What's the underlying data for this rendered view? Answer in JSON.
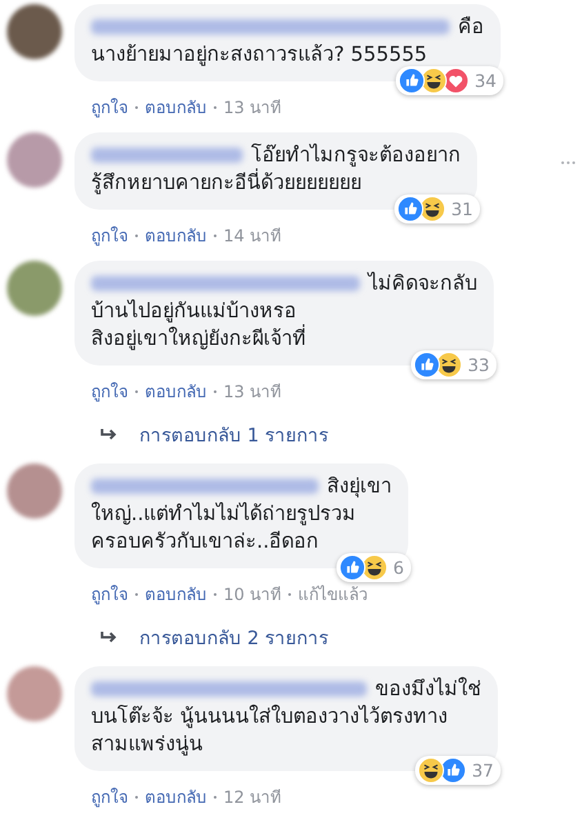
{
  "comments": [
    {
      "text": "คือ\nนางย้ายมาอยู่กะสงถาวรแล้ว? 555555",
      "reactions": [
        {
          "kind": "like"
        },
        {
          "kind": "haha"
        },
        {
          "kind": "love"
        }
      ],
      "reaction_count": "34",
      "actions": [
        "ถูกใจ",
        "ตอบกลับ"
      ],
      "time": "13 นาที",
      "show_menu": false
    },
    {
      "text": "โอ๊ยทำไมกรูจะต้องอยาก\nรู้สึกหยาบคายกะอีนี่ด้วยยยยยยย",
      "reactions": [
        {
          "kind": "like"
        },
        {
          "kind": "haha"
        }
      ],
      "reaction_count": "31",
      "actions": [
        "ถูกใจ",
        "ตอบกลับ"
      ],
      "time": "14 นาที",
      "show_menu": true
    },
    {
      "text": "ไม่คิดจะกลับ\nบ้านไปอยู่กันแม่บ้างหรอ\nสิงอยู่เขาใหญ่ยังกะผีเจ้าที่",
      "reactions": [
        {
          "kind": "like"
        },
        {
          "kind": "haha"
        }
      ],
      "reaction_count": "33",
      "actions": [
        "ถูกใจ",
        "ตอบกลับ"
      ],
      "time": "13 นาที",
      "show_menu": false,
      "replies_label": "การตอบกลับ 1 รายการ"
    },
    {
      "text": "สิงยุ่เขา\nใหญ่..แต่ทำไมไม่ได้ถ่ายรูปรวม\nครอบครัวกับเขาล่ะ..อีดอก",
      "reactions": [
        {
          "kind": "like"
        },
        {
          "kind": "haha"
        }
      ],
      "reaction_count": "6",
      "actions": [
        "ถูกใจ",
        "ตอบกลับ"
      ],
      "time": "10 นาที",
      "edited_label": "แก้ไขแล้ว",
      "show_menu": false,
      "replies_label": "การตอบกลับ 2 รายการ"
    },
    {
      "text": "ของมึงไม่ใช่\nบนโต๊ะจ้ะ นู้นนนนใส่ใบตองวางไว้ตรงทาง\nสามแพร่งนู่น",
      "reactions": [
        {
          "kind": "haha"
        },
        {
          "kind": "like"
        }
      ],
      "reaction_count": "37",
      "actions": [
        "ถูกใจ",
        "ตอบกลับ"
      ],
      "time": "12 นาที",
      "show_menu": false
    }
  ]
}
